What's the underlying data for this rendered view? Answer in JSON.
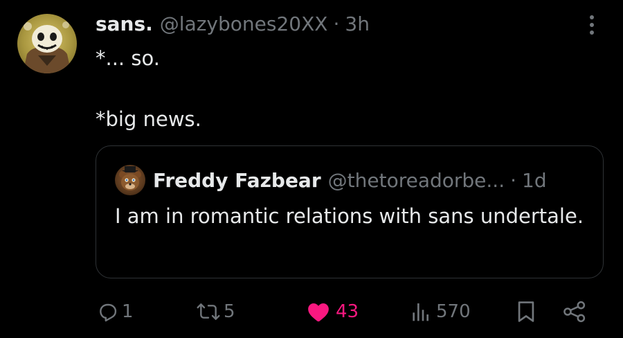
{
  "tweet": {
    "author": {
      "display_name": "sans.",
      "handle": "@lazybones20XX",
      "separator": "·",
      "time": "3h"
    },
    "text_lines": [
      "*... so.",
      "*big news."
    ],
    "quote": {
      "display_name": "Freddy Fazbear",
      "handle": "@thetoreadorbe...",
      "separator": "·",
      "time": "1d",
      "text": "I am in romantic relations with sans undertale."
    },
    "actions": {
      "replies": "1",
      "reposts": "5",
      "likes": "43",
      "views": "570"
    },
    "icons": {
      "reply": "reply-icon",
      "repost": "repost-icon",
      "like": "heart-icon",
      "views": "views-icon",
      "bookmark": "bookmark-icon",
      "share": "share-icon",
      "more": "more-icon"
    }
  },
  "colors": {
    "background": "#000000",
    "text_primary": "#e7e9ea",
    "text_secondary": "#71767b",
    "like_active": "#f91880",
    "border": "#2f3336"
  }
}
